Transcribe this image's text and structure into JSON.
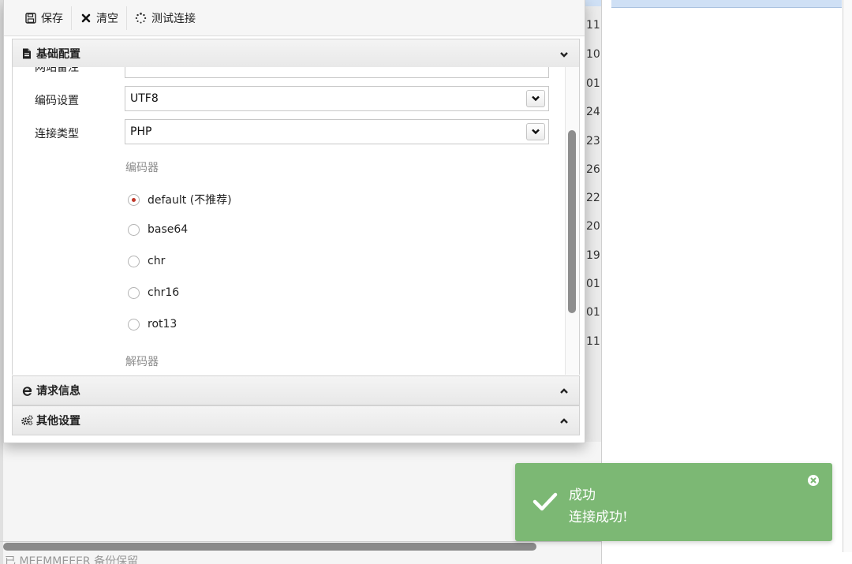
{
  "toolbar": {
    "save_label": "保存",
    "clear_label": "清空",
    "test_label": "测试连接"
  },
  "basic_panel": {
    "title": "基础配置",
    "note_label": "网站备注",
    "encoding_label": "编码设置",
    "encoding_value": "UTF8",
    "conn_type_label": "连接类型",
    "conn_type_value": "PHP",
    "encoder_caption": "编码器",
    "encoders": [
      {
        "label": "default (不推荐)",
        "selected": true
      },
      {
        "label": "base64",
        "selected": false
      },
      {
        "label": "chr",
        "selected": false
      },
      {
        "label": "chr16",
        "selected": false
      },
      {
        "label": "rot13",
        "selected": false
      }
    ],
    "decoder_caption": "解码器"
  },
  "request_panel": {
    "title": "请求信息"
  },
  "other_panel": {
    "title": "其他设置"
  },
  "background": {
    "column_numbers": [
      "11",
      "10",
      "01",
      "24",
      "23",
      "26",
      "22",
      "20",
      "19",
      "01",
      "01",
      "11"
    ],
    "bottom_text": "已 MEEMMEEER 备份保留"
  },
  "toast": {
    "title": "成功",
    "message": "连接成功!",
    "color": "#7cb874"
  }
}
